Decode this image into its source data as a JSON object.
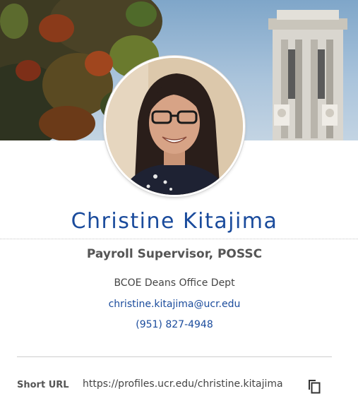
{
  "profile": {
    "name": "Christine Kitajima",
    "title": "Payroll Supervisor, POSSC",
    "department": "BCOE Deans Office Dept",
    "email": "christine.kitajima@ucr.edu",
    "phone": "(951) 827-4948"
  },
  "short_url": {
    "label": "Short URL",
    "value": "https://profiles.ucr.edu/christine.kitajima"
  },
  "icons": {
    "copy": "copy-icon"
  },
  "colors": {
    "accent": "#1a4b9c",
    "heading_gray": "#555555",
    "text": "#444444"
  }
}
